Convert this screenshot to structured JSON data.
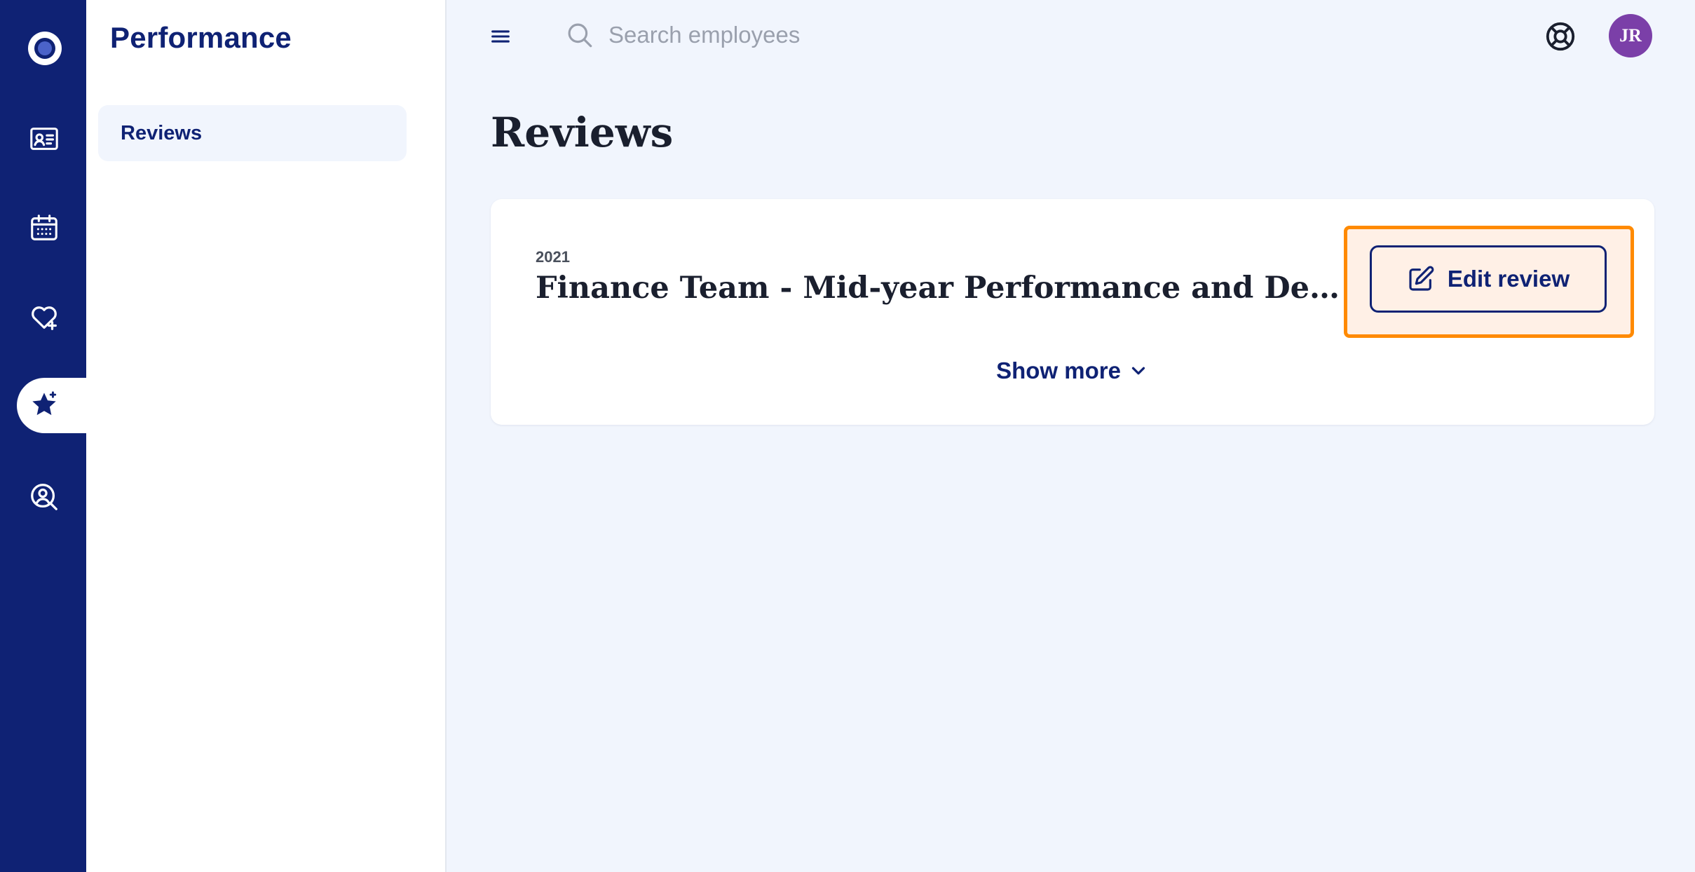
{
  "app": {
    "section_title": "Performance"
  },
  "rail": {
    "items": [
      {
        "icon": "employee-card-icon"
      },
      {
        "icon": "calendar-icon"
      },
      {
        "icon": "heart-plus-icon"
      },
      {
        "icon": "star-icon",
        "active": true
      },
      {
        "icon": "person-search-icon"
      }
    ]
  },
  "subnav": {
    "items": [
      {
        "label": "Reviews",
        "active": true
      }
    ]
  },
  "topbar": {
    "search_placeholder": "Search employees",
    "avatar_initials": "JR"
  },
  "main": {
    "page_title": "Reviews",
    "review": {
      "year": "2021",
      "title": "Finance Team - Mid-year Performance and Development Review",
      "edit_label": "Edit review",
      "show_more_label": "Show more"
    }
  },
  "colors": {
    "navy": "#0f2274",
    "background": "#f1f5fd",
    "highlight": "#ff8a00",
    "avatar": "#7b3fa8"
  }
}
